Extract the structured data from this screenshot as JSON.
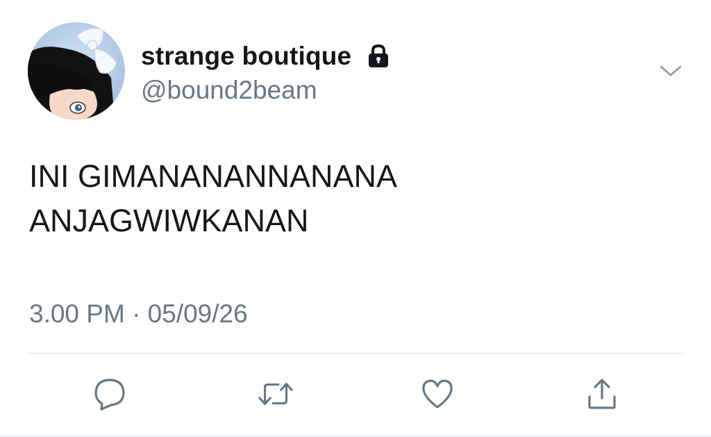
{
  "tweet": {
    "author": {
      "display_name": "strange boutique",
      "handle": "@bound2beam",
      "protected_icon": "lock-icon"
    },
    "text_lines": [
      "INI GIMANANANNANANA",
      "ANJAGWIWKANAN"
    ],
    "timestamp": "3.00 PM · 05/09/26",
    "menu_icon": "chevron-down-icon",
    "actions": [
      {
        "name": "reply",
        "icon": "speech-bubble-icon"
      },
      {
        "name": "retweet",
        "icon": "retweet-arrows-icon"
      },
      {
        "name": "like",
        "icon": "heart-icon"
      },
      {
        "name": "share",
        "icon": "share-upload-icon"
      }
    ]
  },
  "colors": {
    "primary_text": "#14171a",
    "secondary_text": "#657786",
    "icon_gray": "#657786",
    "divider": "#d7dde2",
    "background": "#ffffff"
  }
}
